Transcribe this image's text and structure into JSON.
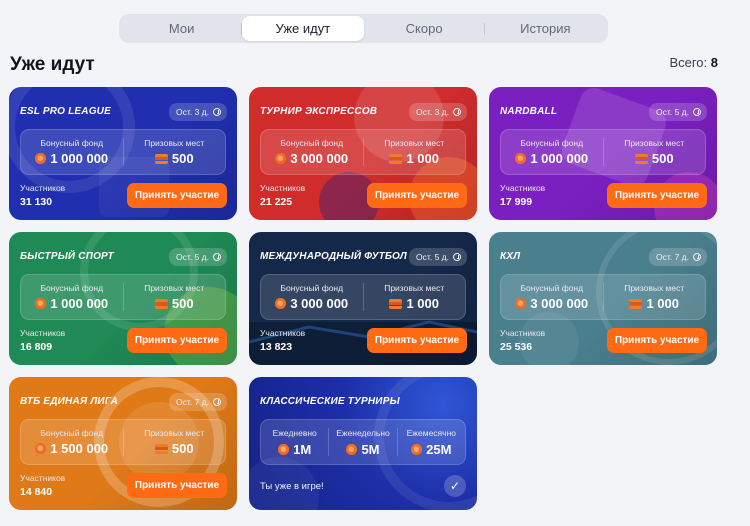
{
  "tabs": [
    {
      "label": "Мои"
    },
    {
      "label": "Уже идут"
    },
    {
      "label": "Скоро"
    },
    {
      "label": "История"
    }
  ],
  "active_tab": "Уже идут",
  "header": {
    "title": "Уже идут",
    "total_label": "Всего:",
    "total_value": "8"
  },
  "common": {
    "fund_label": "Бонусный фонд",
    "places_label": "Призовых мест",
    "participants_label": "Участников",
    "join_label": "Принять участие"
  },
  "tournaments": [
    {
      "title": "ESL PRO LEAGUE",
      "time_left": "Ост. 3 д.",
      "fund": "1 000 000",
      "places": "500",
      "participants": "31 130",
      "color": "#1f2fb0"
    },
    {
      "title": "ТУРНИР ЭКСПРЕССОВ",
      "time_left": "Ост. 3 д.",
      "fund": "3 000 000",
      "places": "1 000",
      "participants": "21 225",
      "color": "#d12c2c"
    },
    {
      "title": "NARDBALL",
      "time_left": "Ост. 5 д.",
      "fund": "1 000 000",
      "places": "500",
      "participants": "17 999",
      "color": "#7a1fc0"
    },
    {
      "title": "БЫСТРЫЙ СПОРТ",
      "time_left": "Ост. 5 д.",
      "fund": "1 000 000",
      "places": "500",
      "participants": "16 809",
      "color": "#1f8a55"
    },
    {
      "title": "МЕЖДУНАРОДНЫЙ ФУТБОЛ",
      "time_left": "Ост. 5 д.",
      "fund": "3 000 000",
      "places": "1 000",
      "participants": "13 823",
      "color": "#14284a"
    },
    {
      "title": "КХЛ",
      "time_left": "Ост. 7 д.",
      "fund": "3 000 000",
      "places": "1 000",
      "participants": "25 536",
      "color": "#4a7f8e"
    },
    {
      "title": "ВТБ ЕДИНАЯ ЛИГА",
      "time_left": "Ост. 7 д.",
      "fund": "1 500 000",
      "places": "500",
      "participants": "14 840",
      "color": "#e07a18"
    }
  ],
  "classic": {
    "title": "КЛАССИЧЕСКИЕ ТУРНИРЫ",
    "periods": [
      {
        "label": "Ежедневно",
        "value": "1M"
      },
      {
        "label": "Еженедельно",
        "value": "5M"
      },
      {
        "label": "Ежемесячно",
        "value": "25M"
      }
    ],
    "in_game_text": "Ты уже в игре!"
  }
}
